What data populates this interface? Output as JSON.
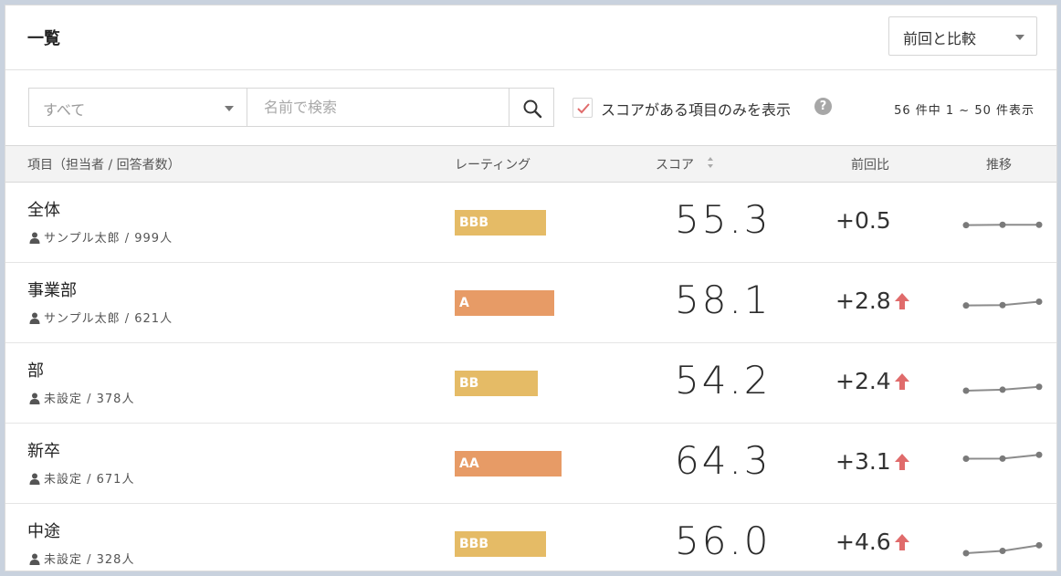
{
  "panel": {
    "title": "一覧"
  },
  "compare": {
    "selected": "前回と比較"
  },
  "filter": {
    "category_selected": "すべて",
    "search_placeholder": "名前で検索",
    "search_value": "",
    "only_scored_checked": true,
    "only_scored_label": "スコアがある項目のみを表示",
    "help": "?",
    "count_text": "56 件中 1 ~ 50 件表示"
  },
  "columns": {
    "item": "項目（担当者 / 回答者数）",
    "rating": "レーティング",
    "score": "スコア",
    "diff": "前回比",
    "trend": "推移"
  },
  "colors": {
    "rating_yellow": "#e5bb66",
    "rating_orange": "#e79b66",
    "arrow_up": "#e06b6b",
    "trend_line": "#8c8c8c"
  },
  "rows": [
    {
      "name": "全体",
      "sub": "サンプル太郎 / 999人",
      "rating": "BBB",
      "rating_color": "yellow",
      "rating_level": 0.77,
      "score": "55.3",
      "diff": "+0.5",
      "diff_up": false,
      "trend": [
        55.0,
        55.3,
        55.3
      ]
    },
    {
      "name": "事業部",
      "sub": "サンプル太郎 / 621人",
      "rating": "A",
      "rating_color": "orange",
      "rating_level": 0.84,
      "score": "58.1",
      "diff": "+2.8",
      "diff_up": true,
      "trend": [
        55.0,
        55.3,
        58.1
      ]
    },
    {
      "name": "部",
      "sub": "未設定 / 378人",
      "rating": "BB",
      "rating_color": "yellow",
      "rating_level": 0.7,
      "score": "54.2",
      "diff": "+2.4",
      "diff_up": true,
      "trend": [
        51.0,
        51.8,
        54.2
      ]
    },
    {
      "name": "新卒",
      "sub": "未設定 / 671人",
      "rating": "AA",
      "rating_color": "orange",
      "rating_level": 0.9,
      "score": "64.3",
      "diff": "+3.1",
      "diff_up": true,
      "trend": [
        61.1,
        61.2,
        64.3
      ]
    },
    {
      "name": "中途",
      "sub": "未設定 / 328人",
      "rating": "BBB",
      "rating_color": "yellow",
      "rating_level": 0.77,
      "score": "56.0",
      "diff": "+4.6",
      "diff_up": true,
      "trend": [
        49.5,
        51.4,
        56.0
      ]
    }
  ]
}
